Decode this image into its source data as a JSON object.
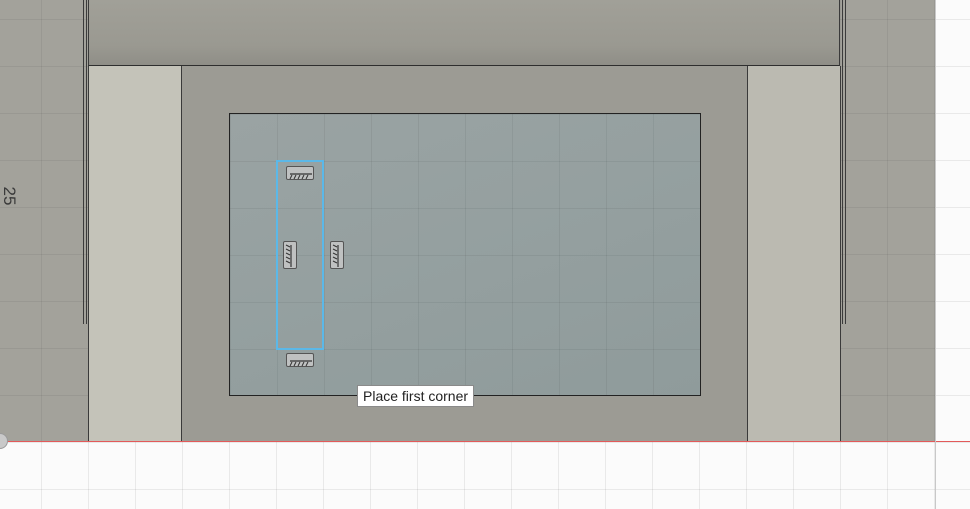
{
  "viewport": {
    "ruler_label": "25",
    "tooltip_text": "Place first corner"
  },
  "icons": {
    "constraint": "horizontal-vertical-constraint-icon",
    "origin": "origin-point-icon"
  },
  "colors": {
    "body_fill": "#a3a29b",
    "sketch_fill": "#95a0a0",
    "preview_stroke": "#5bb8e8",
    "x_axis": "#e35a5a"
  }
}
